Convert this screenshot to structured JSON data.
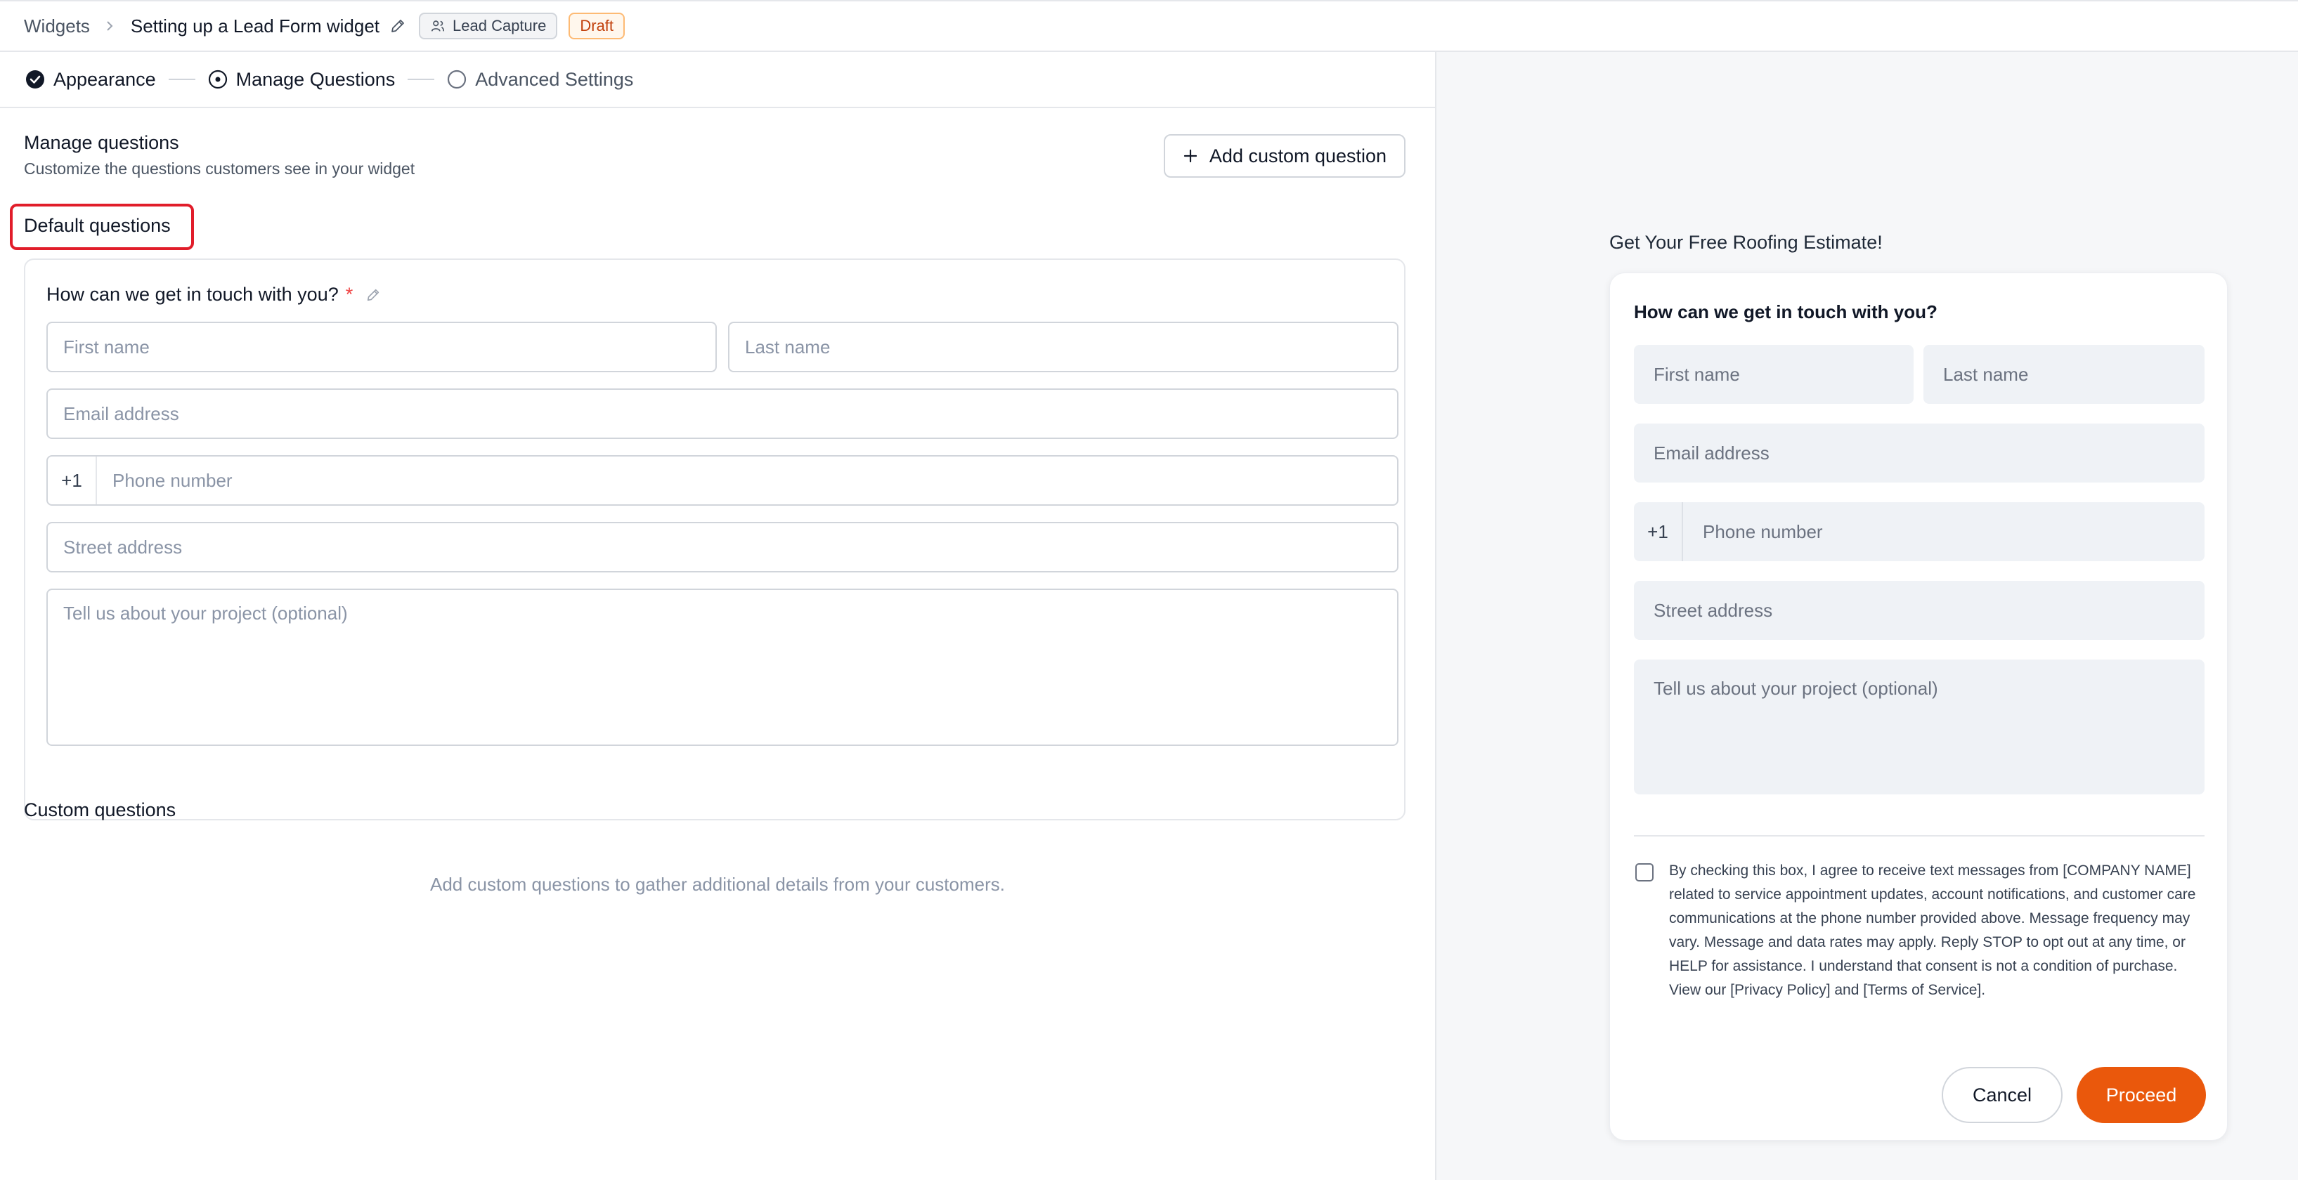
{
  "breadcrumb": {
    "root": "Widgets",
    "title": "Setting up a Lead Form widget",
    "tag_type": "Lead Capture",
    "tag_status": "Draft"
  },
  "stepper": {
    "steps": [
      {
        "label": "Appearance",
        "state": "done"
      },
      {
        "label": "Manage Questions",
        "state": "active"
      },
      {
        "label": "Advanced Settings",
        "state": "pending"
      }
    ]
  },
  "manage": {
    "title": "Manage questions",
    "subtitle": "Customize the questions customers see in your widget",
    "add_button": "Add custom question"
  },
  "default_questions": {
    "title": "Default questions",
    "question_label": "How can we get in touch with you?",
    "required_mark": "*",
    "fields": {
      "first_name": "First name",
      "last_name": "Last name",
      "email": "Email address",
      "phone_prefix": "+1",
      "phone": "Phone number",
      "street": "Street address",
      "project": "Tell us about your project (optional)"
    }
  },
  "custom_questions": {
    "title": "Custom questions",
    "empty_text": "Add custom questions to gather additional details from your customers."
  },
  "preview": {
    "title": "Get Your Free Roofing Estimate!",
    "question": "How can we get in touch with you?",
    "fields": {
      "first_name": "First name",
      "last_name": "Last name",
      "email": "Email address",
      "phone_prefix": "+1",
      "phone": "Phone number",
      "street": "Street address",
      "project": "Tell us about your project (optional)"
    },
    "consent": "By checking this box, I agree to receive text messages from [COMPANY NAME] related to service appointment updates, account notifications, and customer care communications at the phone number provided above. Message frequency may vary. Message and data rates may apply. Reply STOP to opt out at any time, or HELP for assistance. I understand that consent is not a condition of purchase. View our [Privacy Policy] and [Terms of Service].",
    "cancel": "Cancel",
    "proceed": "Proceed"
  },
  "colors": {
    "accent": "#ea580c",
    "highlight": "#e11d2a",
    "required": "#ef4444"
  }
}
